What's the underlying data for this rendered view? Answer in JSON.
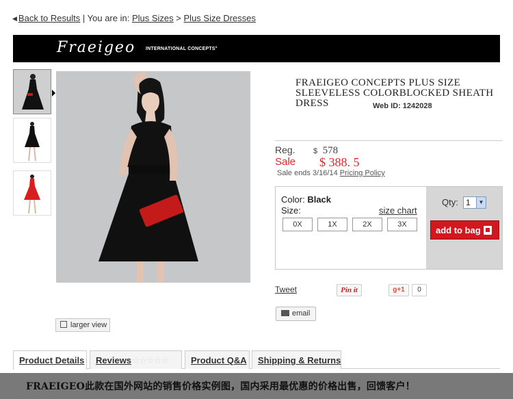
{
  "breadcrumb": {
    "back_label": "Back to Results",
    "separator": "|",
    "you_are_in": "You are in:",
    "crumb1": "Plus Sizes",
    "gt": ">",
    "crumb2": "Plus Size Dresses"
  },
  "brand": {
    "logo_text": "Fraeigeo",
    "tagline": "INTERNATIONAL CONCEPTS°"
  },
  "gallery": {
    "thumbnails": [
      "black dress front",
      "black dress full",
      "red dress full"
    ],
    "larger_view_label": "larger view"
  },
  "product": {
    "title": "FRAEIGEO CONCEPTS PLUS SIZE SLEEVELESS COLORBLOCKED SHEATH DRESS",
    "web_id": "Web ID: 1242028",
    "reg_label": "Reg.",
    "reg_price": "$  578",
    "sale_label": "Sale",
    "sale_price": "$  388. 5",
    "sale_ends": "Sale ends 3/16/14",
    "pricing_policy": "Pricing Policy"
  },
  "options": {
    "color_label": "Color:",
    "color_value": "Black",
    "size_label": "Size:",
    "size_chart": "size chart",
    "sizes": [
      "0X",
      "1X",
      "2X",
      "3X"
    ],
    "qty_label": "Qty:",
    "qty_value": "1",
    "add_to_bag": "add to bag"
  },
  "social": {
    "tweet": "Tweet",
    "pinit": "Pin it",
    "gplus": "g+1",
    "gplus_count": "0",
    "email": "email"
  },
  "tabs": [
    "Product Details",
    "Reviews",
    "Product Q&A",
    "Shipping & Returns"
  ],
  "reviews_stars": "☆☆☆☆☆",
  "banner_text": "FRAEIGEO此款在国外网站的销售价格实例图，国内采用最优惠的价格出售，回馈客户！",
  "colors": {
    "sale_red": "#e8232a",
    "add_bag_red": "#d2171e",
    "brand_bar": "#000000"
  }
}
